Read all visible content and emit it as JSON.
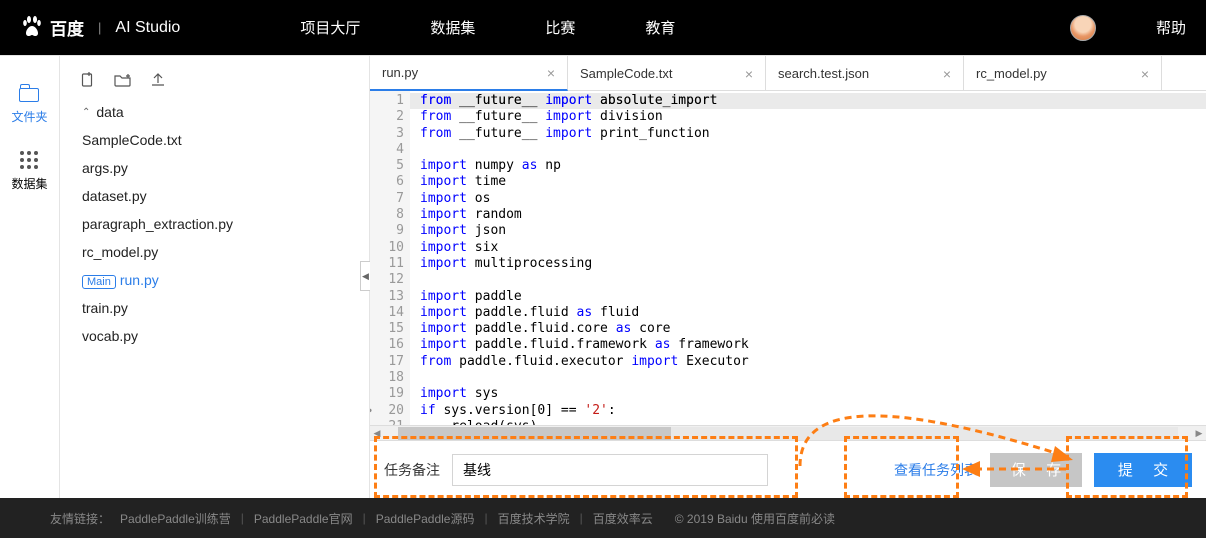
{
  "header": {
    "logo_main": "百度",
    "logo_sub": "AI Studio",
    "nav": [
      "项目大厅",
      "数据集",
      "比赛",
      "教育"
    ],
    "help": "帮助"
  },
  "rail": {
    "folder": "文件夹",
    "dataset": "数据集"
  },
  "files": {
    "folder": "data",
    "items": [
      "SampleCode.txt",
      "args.py",
      "dataset.py",
      "paragraph_extraction.py",
      "rc_model.py"
    ],
    "main_badge": "Main",
    "main_file": "run.py",
    "rest": [
      "train.py",
      "vocab.py"
    ]
  },
  "tabs": [
    {
      "name": "run.py",
      "active": true
    },
    {
      "name": "SampleCode.txt",
      "active": false
    },
    {
      "name": "search.test.json",
      "active": false
    },
    {
      "name": "rc_model.py",
      "active": false
    }
  ],
  "bottom": {
    "task_label": "任务备注",
    "task_value": "基线",
    "view_tasks": "查看任务列表",
    "save": "保 存",
    "submit": "提 交"
  },
  "footer": {
    "label": "友情链接：",
    "links": [
      "PaddlePaddle训练营",
      "PaddlePaddle官网",
      "PaddlePaddle源码",
      "百度技术学院",
      "百度效率云"
    ],
    "copy": "© 2019 Baidu 使用百度前必读"
  },
  "chart_data": null
}
